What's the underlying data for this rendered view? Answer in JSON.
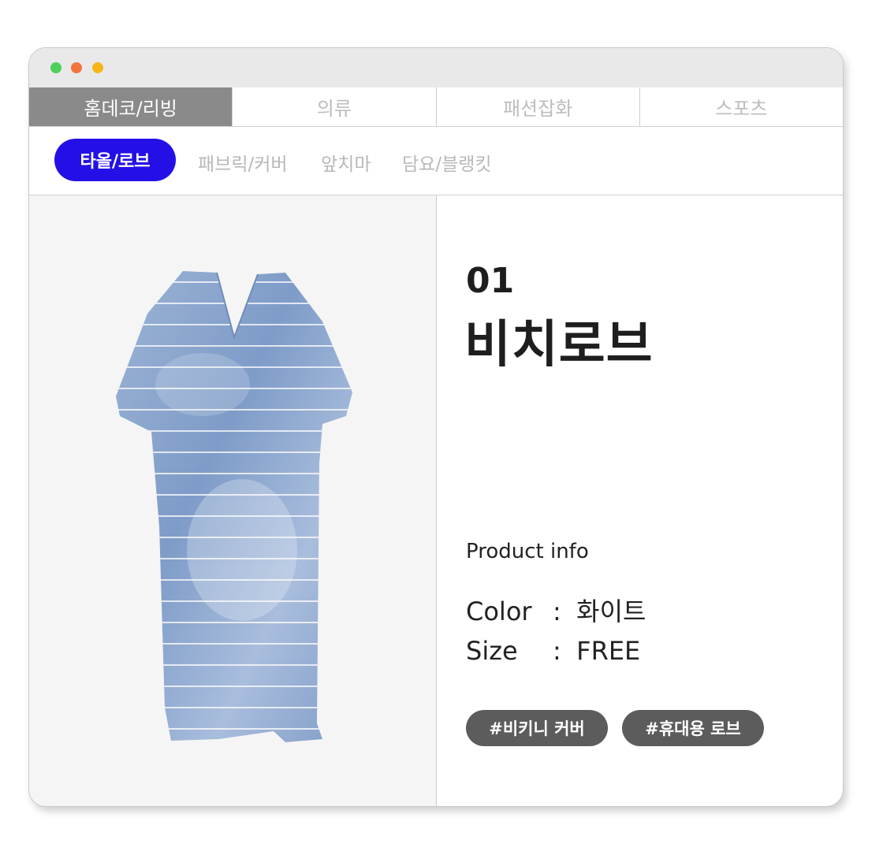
{
  "tabs": [
    "홈데코/리빙",
    "의류",
    "패션잡화",
    "스포츠"
  ],
  "subcategories": [
    "타올/로브",
    "패브릭/커버",
    "앞치마",
    "담요/블랭킷"
  ],
  "product": {
    "number": "01",
    "name": "비치로브",
    "info_title": "Product info",
    "color_label": "Color",
    "color_value": "화이트",
    "size_label": "Size",
    "size_value": "FREE",
    "separator": ":"
  },
  "tags": [
    "#비키니 커버",
    "#휴대용 로브"
  ],
  "colors": {
    "active_pill": "#2410e6",
    "active_tab": "#8a8a8a",
    "tag_bg": "#5c5c5c",
    "robe": "#8ea8cf"
  }
}
